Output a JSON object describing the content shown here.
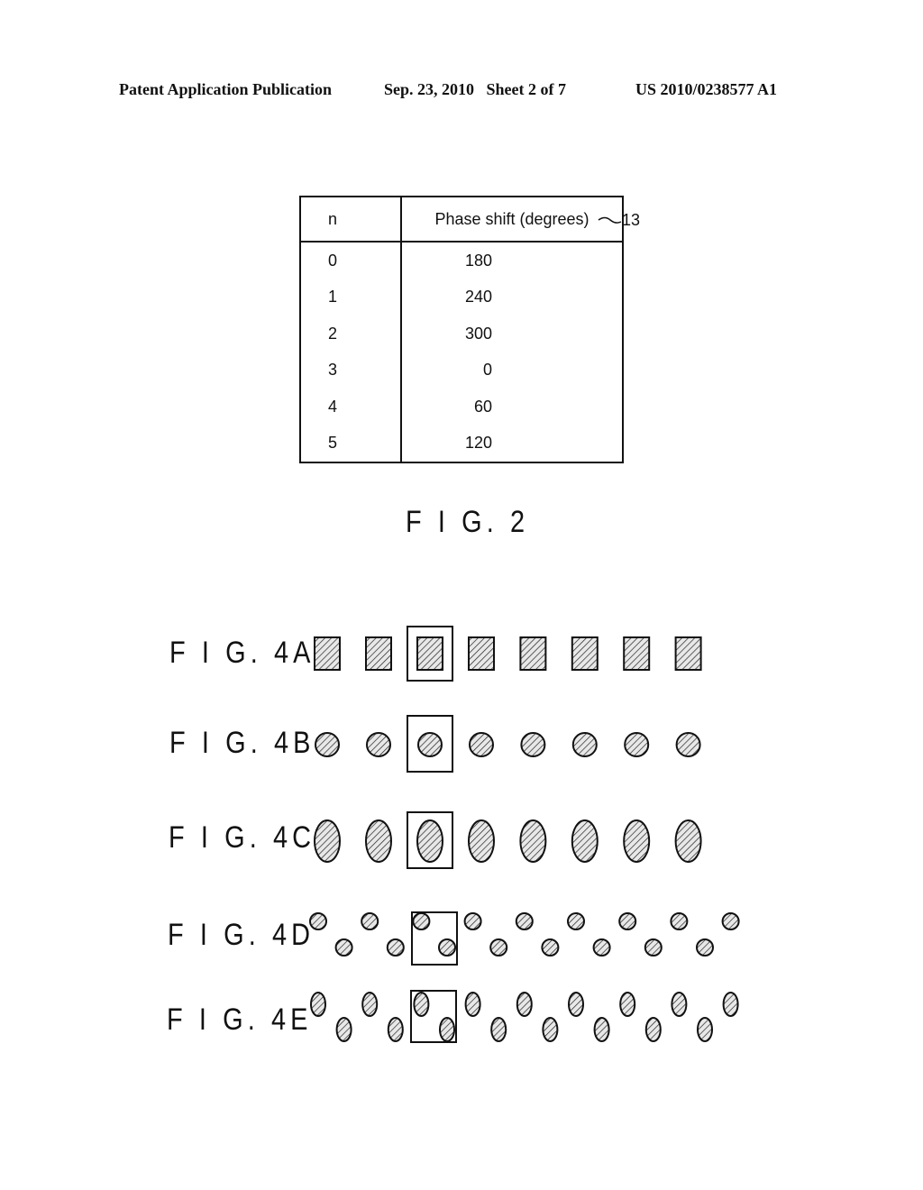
{
  "header": {
    "left": "Patent Application Publication",
    "center": "Sep. 23, 2010   Sheet 2 of 7",
    "right": "US 2010/0238577 A1"
  },
  "fig2": {
    "caption": "F I G. 2",
    "reference_numeral": "13",
    "table": {
      "columns": [
        "n",
        "Phase shift (degrees)"
      ],
      "rows": [
        {
          "n": "0",
          "phase": "180"
        },
        {
          "n": "1",
          "phase": "240"
        },
        {
          "n": "2",
          "phase": "300"
        },
        {
          "n": "3",
          "phase": "0"
        },
        {
          "n": "4",
          "phase": "60"
        },
        {
          "n": "5",
          "phase": "120"
        }
      ]
    }
  },
  "fig4": [
    {
      "label": "F I G. 4A",
      "shape": "rectangle",
      "count": 8,
      "layout": "single-row",
      "highlighted_index": 2
    },
    {
      "label": "F I G. 4B",
      "shape": "circle",
      "count": 8,
      "layout": "single-row",
      "highlighted_index": 2
    },
    {
      "label": "F I G. 4C",
      "shape": "ellipse",
      "count": 8,
      "layout": "single-row",
      "highlighted_index": 2
    },
    {
      "label": "F I G. 4D",
      "shape": "circle",
      "count": 17,
      "layout": "staggered",
      "highlighted_pair": 2
    },
    {
      "label": "F I G. 4E",
      "shape": "ellipse",
      "count": 17,
      "layout": "staggered",
      "highlighted_pair": 2
    }
  ]
}
